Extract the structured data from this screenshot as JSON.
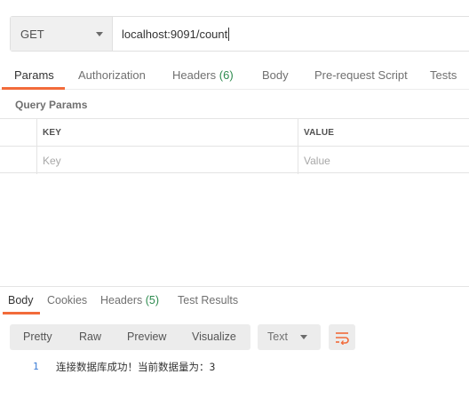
{
  "request": {
    "method": "GET",
    "url": "localhost:9091/count"
  },
  "request_tabs": [
    {
      "label": "Params",
      "active": true
    },
    {
      "label": "Authorization"
    },
    {
      "label": "Headers",
      "count": "(6)"
    },
    {
      "label": "Body"
    },
    {
      "label": "Pre-request Script"
    },
    {
      "label": "Tests"
    }
  ],
  "params": {
    "section_title": "Query Params",
    "key_header": "KEY",
    "value_header": "VALUE",
    "key_placeholder": "Key",
    "value_placeholder": "Value"
  },
  "response_tabs": [
    {
      "label": "Body",
      "active": true
    },
    {
      "label": "Cookies"
    },
    {
      "label": "Headers",
      "count": "(5)"
    },
    {
      "label": "Test Results"
    }
  ],
  "response_view": {
    "modes": [
      "Pretty",
      "Raw",
      "Preview",
      "Visualize"
    ],
    "format": "Text"
  },
  "response_body": {
    "line_number": "1",
    "text": "连接数据库成功！当前数据量为：3"
  },
  "colors": {
    "accent": "#f26b3a",
    "count_green": "#2e8b4f",
    "line_number_blue": "#3a7bd5"
  },
  "icons": {
    "method_dropdown": "chevron-down-icon",
    "format_dropdown": "chevron-down-icon",
    "wrap": "wrap-lines-icon"
  }
}
